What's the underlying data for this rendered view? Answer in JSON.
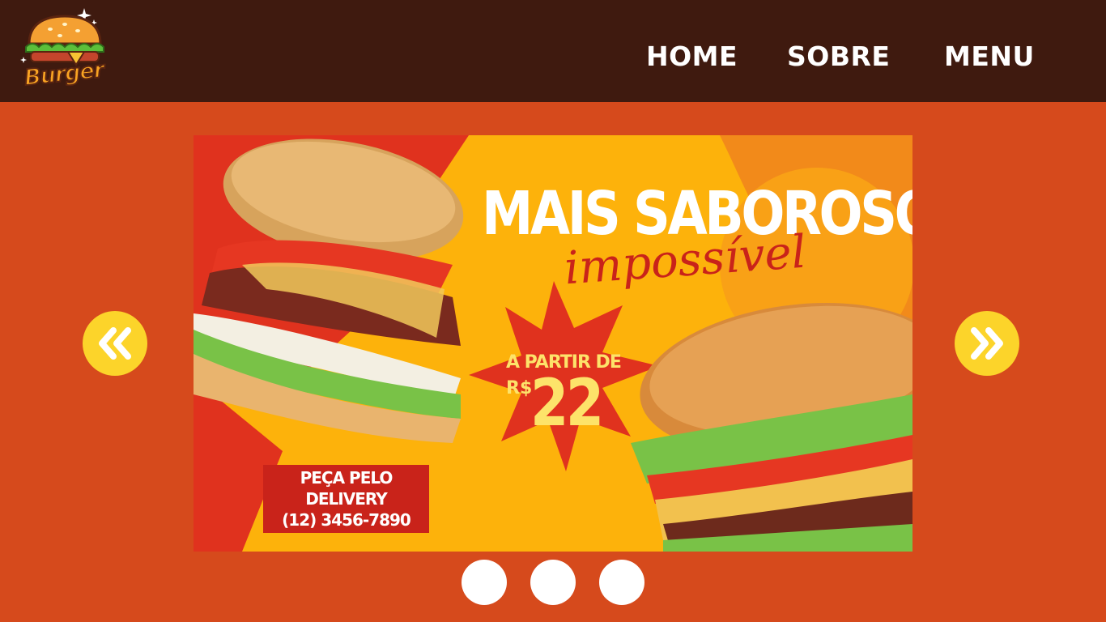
{
  "header": {
    "logo_text": "Burger",
    "nav": [
      {
        "label": "HOME"
      },
      {
        "label": "SOBRE"
      },
      {
        "label": "MENU"
      }
    ]
  },
  "carousel": {
    "banner": {
      "headline": "MAIS SABOROSO",
      "script": "impossível",
      "price_prefix": "A PARTIR DE",
      "currency": "R$",
      "price": "22",
      "delivery_line1": "PEÇA PELO DELIVERY",
      "delivery_phone": "(12) 3456-7890"
    },
    "prev_icon": "double-chevron-left-icon",
    "next_icon": "double-chevron-right-icon",
    "slide_count": 3
  },
  "colors": {
    "page_bg": "#d64a1c",
    "header_bg": "#3f1a0f",
    "nav_text": "#ffffff",
    "arrow_bg": "#fcd42a",
    "banner_bg": "#fdb20b",
    "banner_red": "#e0321e",
    "dot": "#ffffff"
  }
}
